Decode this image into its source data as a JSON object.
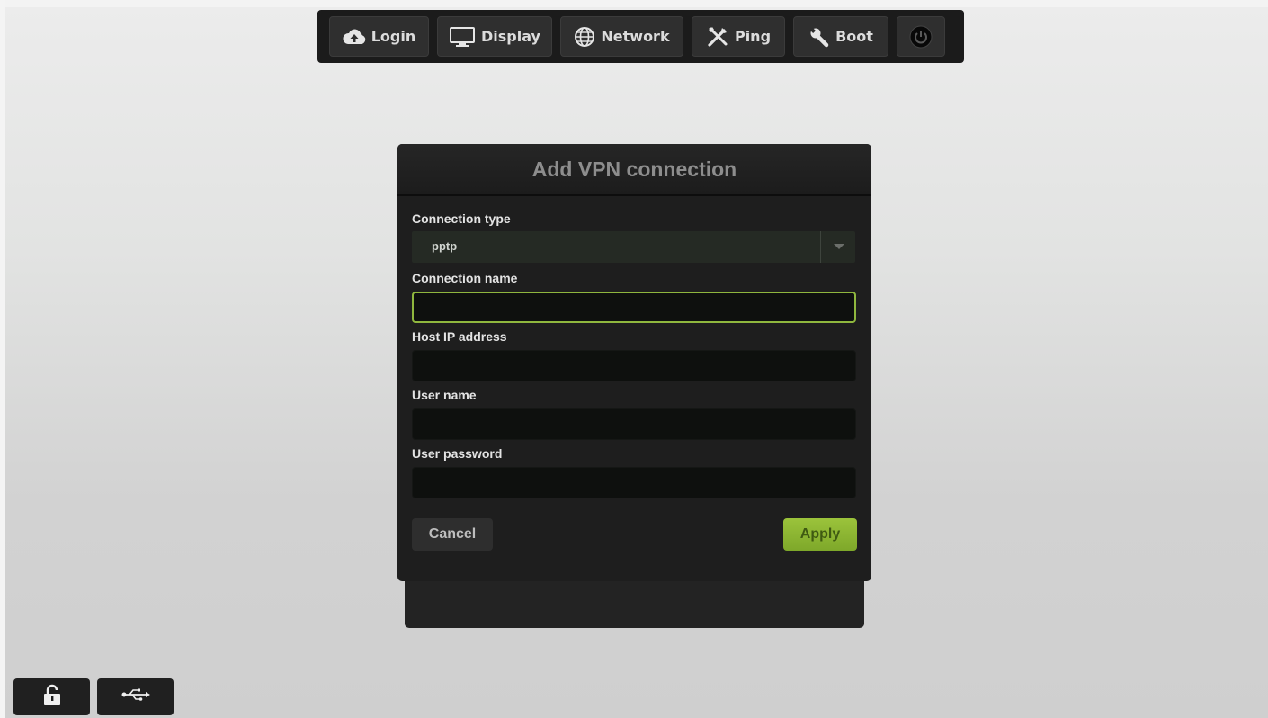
{
  "toolbar": {
    "items": [
      {
        "label": "Login",
        "icon": "cloud-upload-icon"
      },
      {
        "label": "Display",
        "icon": "monitor-icon"
      },
      {
        "label": "Network",
        "icon": "globe-icon"
      },
      {
        "label": "Ping",
        "icon": "tools-icon"
      },
      {
        "label": "Boot",
        "icon": "wrench-icon"
      },
      {
        "label": "",
        "icon": "power-icon"
      }
    ]
  },
  "dialog": {
    "title": "Add VPN connection",
    "connection_type": {
      "label": "Connection type",
      "value": "pptp"
    },
    "connection_name": {
      "label": "Connection name",
      "value": ""
    },
    "host_ip": {
      "label": "Host IP address",
      "value": ""
    },
    "user_name": {
      "label": "User name",
      "value": ""
    },
    "user_password": {
      "label": "User password",
      "value": ""
    },
    "cancel_label": "Cancel",
    "apply_label": "Apply"
  },
  "colors": {
    "accent": "#8fb73e",
    "toolbar_bg": "#1b1b1b",
    "dialog_bg": "#1e1e1e"
  },
  "bottom_bar": {
    "items": [
      {
        "icon": "unlock-icon"
      },
      {
        "icon": "usb-icon"
      }
    ]
  }
}
